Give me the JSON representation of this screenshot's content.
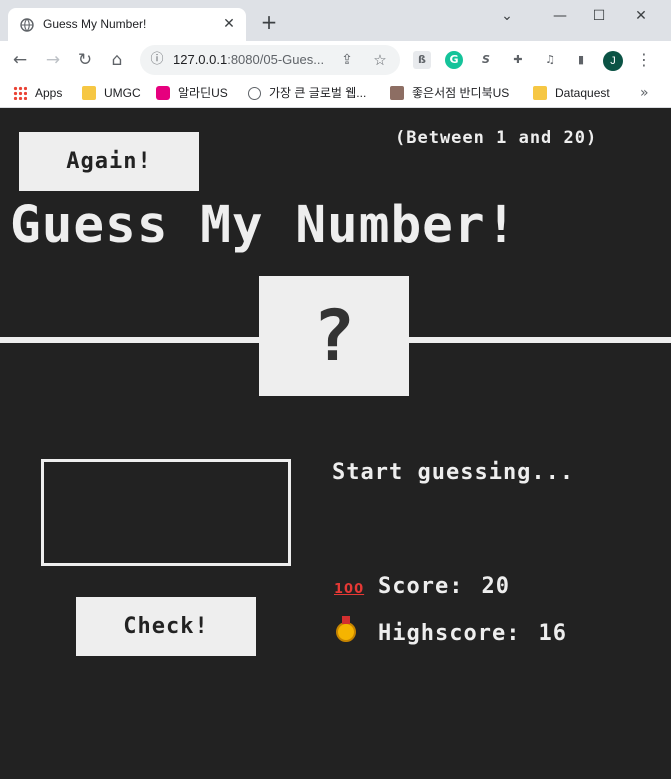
{
  "browser": {
    "tab_title": "Guess My Number!",
    "tab_close": "✕",
    "new_tab": "+",
    "url_host": "127.0.0.1",
    "url_rest": ":8080/05-Gues...",
    "window_controls": [
      "⌄",
      "—",
      "☐",
      "✕"
    ],
    "avatar_letter": "J",
    "bookmarks": [
      {
        "label": "Apps",
        "icon": "apps-grid-icon"
      },
      {
        "label": "UMGC",
        "icon": "folder-icon"
      },
      {
        "label": "알라딘US",
        "icon": "aladin-icon"
      },
      {
        "label": "가장 큰 글로벌 웹...",
        "icon": "globe-icon"
      },
      {
        "label": "좋은서점 반디북US",
        "icon": "bandi-icon"
      },
      {
        "label": "Dataquest",
        "icon": "folder-icon"
      }
    ],
    "bookmarks_more": "»"
  },
  "game": {
    "again_label": "Again!",
    "between_text": "(Between 1 and 20)",
    "headline": "Guess My Number!",
    "secret_number": "?",
    "guess_value": "",
    "check_label": "Check!",
    "message": "Start guessing...",
    "score_label": "Score:",
    "score_value": "20",
    "highscore_label": "Highscore:",
    "highscore_value": "16",
    "score_emoji": "💯",
    "highscore_emoji": "🥇"
  },
  "colors": {
    "page_bg": "#222222",
    "text": "#eeeeee",
    "button_bg": "#eeeeee"
  }
}
